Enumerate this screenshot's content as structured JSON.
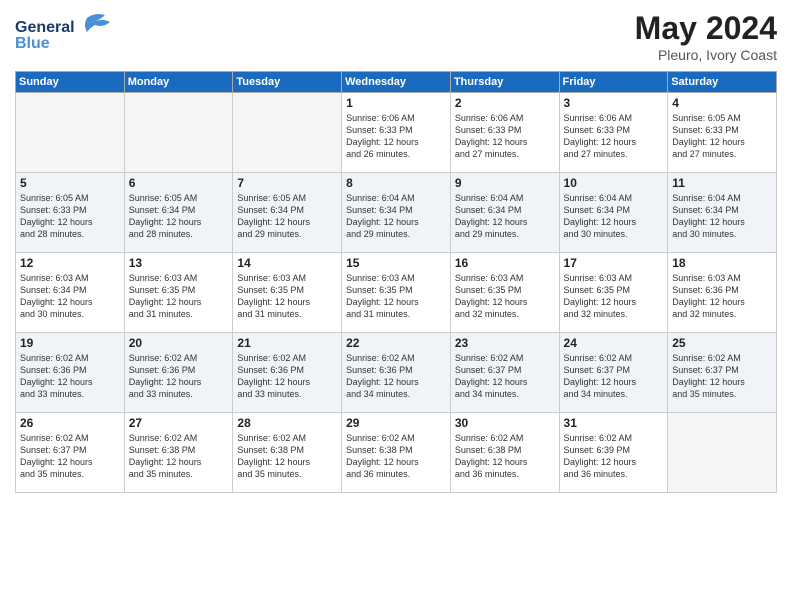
{
  "logo": {
    "text1": "General",
    "text2": "Blue"
  },
  "title": "May 2024",
  "location": "Pleuro, Ivory Coast",
  "weekdays": [
    "Sunday",
    "Monday",
    "Tuesday",
    "Wednesday",
    "Thursday",
    "Friday",
    "Saturday"
  ],
  "weeks": [
    [
      {
        "day": "",
        "info": ""
      },
      {
        "day": "",
        "info": ""
      },
      {
        "day": "",
        "info": ""
      },
      {
        "day": "1",
        "info": "Sunrise: 6:06 AM\nSunset: 6:33 PM\nDaylight: 12 hours\nand 26 minutes."
      },
      {
        "day": "2",
        "info": "Sunrise: 6:06 AM\nSunset: 6:33 PM\nDaylight: 12 hours\nand 27 minutes."
      },
      {
        "day": "3",
        "info": "Sunrise: 6:06 AM\nSunset: 6:33 PM\nDaylight: 12 hours\nand 27 minutes."
      },
      {
        "day": "4",
        "info": "Sunrise: 6:05 AM\nSunset: 6:33 PM\nDaylight: 12 hours\nand 27 minutes."
      }
    ],
    [
      {
        "day": "5",
        "info": "Sunrise: 6:05 AM\nSunset: 6:33 PM\nDaylight: 12 hours\nand 28 minutes."
      },
      {
        "day": "6",
        "info": "Sunrise: 6:05 AM\nSunset: 6:34 PM\nDaylight: 12 hours\nand 28 minutes."
      },
      {
        "day": "7",
        "info": "Sunrise: 6:05 AM\nSunset: 6:34 PM\nDaylight: 12 hours\nand 29 minutes."
      },
      {
        "day": "8",
        "info": "Sunrise: 6:04 AM\nSunset: 6:34 PM\nDaylight: 12 hours\nand 29 minutes."
      },
      {
        "day": "9",
        "info": "Sunrise: 6:04 AM\nSunset: 6:34 PM\nDaylight: 12 hours\nand 29 minutes."
      },
      {
        "day": "10",
        "info": "Sunrise: 6:04 AM\nSunset: 6:34 PM\nDaylight: 12 hours\nand 30 minutes."
      },
      {
        "day": "11",
        "info": "Sunrise: 6:04 AM\nSunset: 6:34 PM\nDaylight: 12 hours\nand 30 minutes."
      }
    ],
    [
      {
        "day": "12",
        "info": "Sunrise: 6:03 AM\nSunset: 6:34 PM\nDaylight: 12 hours\nand 30 minutes."
      },
      {
        "day": "13",
        "info": "Sunrise: 6:03 AM\nSunset: 6:35 PM\nDaylight: 12 hours\nand 31 minutes."
      },
      {
        "day": "14",
        "info": "Sunrise: 6:03 AM\nSunset: 6:35 PM\nDaylight: 12 hours\nand 31 minutes."
      },
      {
        "day": "15",
        "info": "Sunrise: 6:03 AM\nSunset: 6:35 PM\nDaylight: 12 hours\nand 31 minutes."
      },
      {
        "day": "16",
        "info": "Sunrise: 6:03 AM\nSunset: 6:35 PM\nDaylight: 12 hours\nand 32 minutes."
      },
      {
        "day": "17",
        "info": "Sunrise: 6:03 AM\nSunset: 6:35 PM\nDaylight: 12 hours\nand 32 minutes."
      },
      {
        "day": "18",
        "info": "Sunrise: 6:03 AM\nSunset: 6:36 PM\nDaylight: 12 hours\nand 32 minutes."
      }
    ],
    [
      {
        "day": "19",
        "info": "Sunrise: 6:02 AM\nSunset: 6:36 PM\nDaylight: 12 hours\nand 33 minutes."
      },
      {
        "day": "20",
        "info": "Sunrise: 6:02 AM\nSunset: 6:36 PM\nDaylight: 12 hours\nand 33 minutes."
      },
      {
        "day": "21",
        "info": "Sunrise: 6:02 AM\nSunset: 6:36 PM\nDaylight: 12 hours\nand 33 minutes."
      },
      {
        "day": "22",
        "info": "Sunrise: 6:02 AM\nSunset: 6:36 PM\nDaylight: 12 hours\nand 34 minutes."
      },
      {
        "day": "23",
        "info": "Sunrise: 6:02 AM\nSunset: 6:37 PM\nDaylight: 12 hours\nand 34 minutes."
      },
      {
        "day": "24",
        "info": "Sunrise: 6:02 AM\nSunset: 6:37 PM\nDaylight: 12 hours\nand 34 minutes."
      },
      {
        "day": "25",
        "info": "Sunrise: 6:02 AM\nSunset: 6:37 PM\nDaylight: 12 hours\nand 35 minutes."
      }
    ],
    [
      {
        "day": "26",
        "info": "Sunrise: 6:02 AM\nSunset: 6:37 PM\nDaylight: 12 hours\nand 35 minutes."
      },
      {
        "day": "27",
        "info": "Sunrise: 6:02 AM\nSunset: 6:38 PM\nDaylight: 12 hours\nand 35 minutes."
      },
      {
        "day": "28",
        "info": "Sunrise: 6:02 AM\nSunset: 6:38 PM\nDaylight: 12 hours\nand 35 minutes."
      },
      {
        "day": "29",
        "info": "Sunrise: 6:02 AM\nSunset: 6:38 PM\nDaylight: 12 hours\nand 36 minutes."
      },
      {
        "day": "30",
        "info": "Sunrise: 6:02 AM\nSunset: 6:38 PM\nDaylight: 12 hours\nand 36 minutes."
      },
      {
        "day": "31",
        "info": "Sunrise: 6:02 AM\nSunset: 6:39 PM\nDaylight: 12 hours\nand 36 minutes."
      },
      {
        "day": "",
        "info": ""
      }
    ]
  ]
}
